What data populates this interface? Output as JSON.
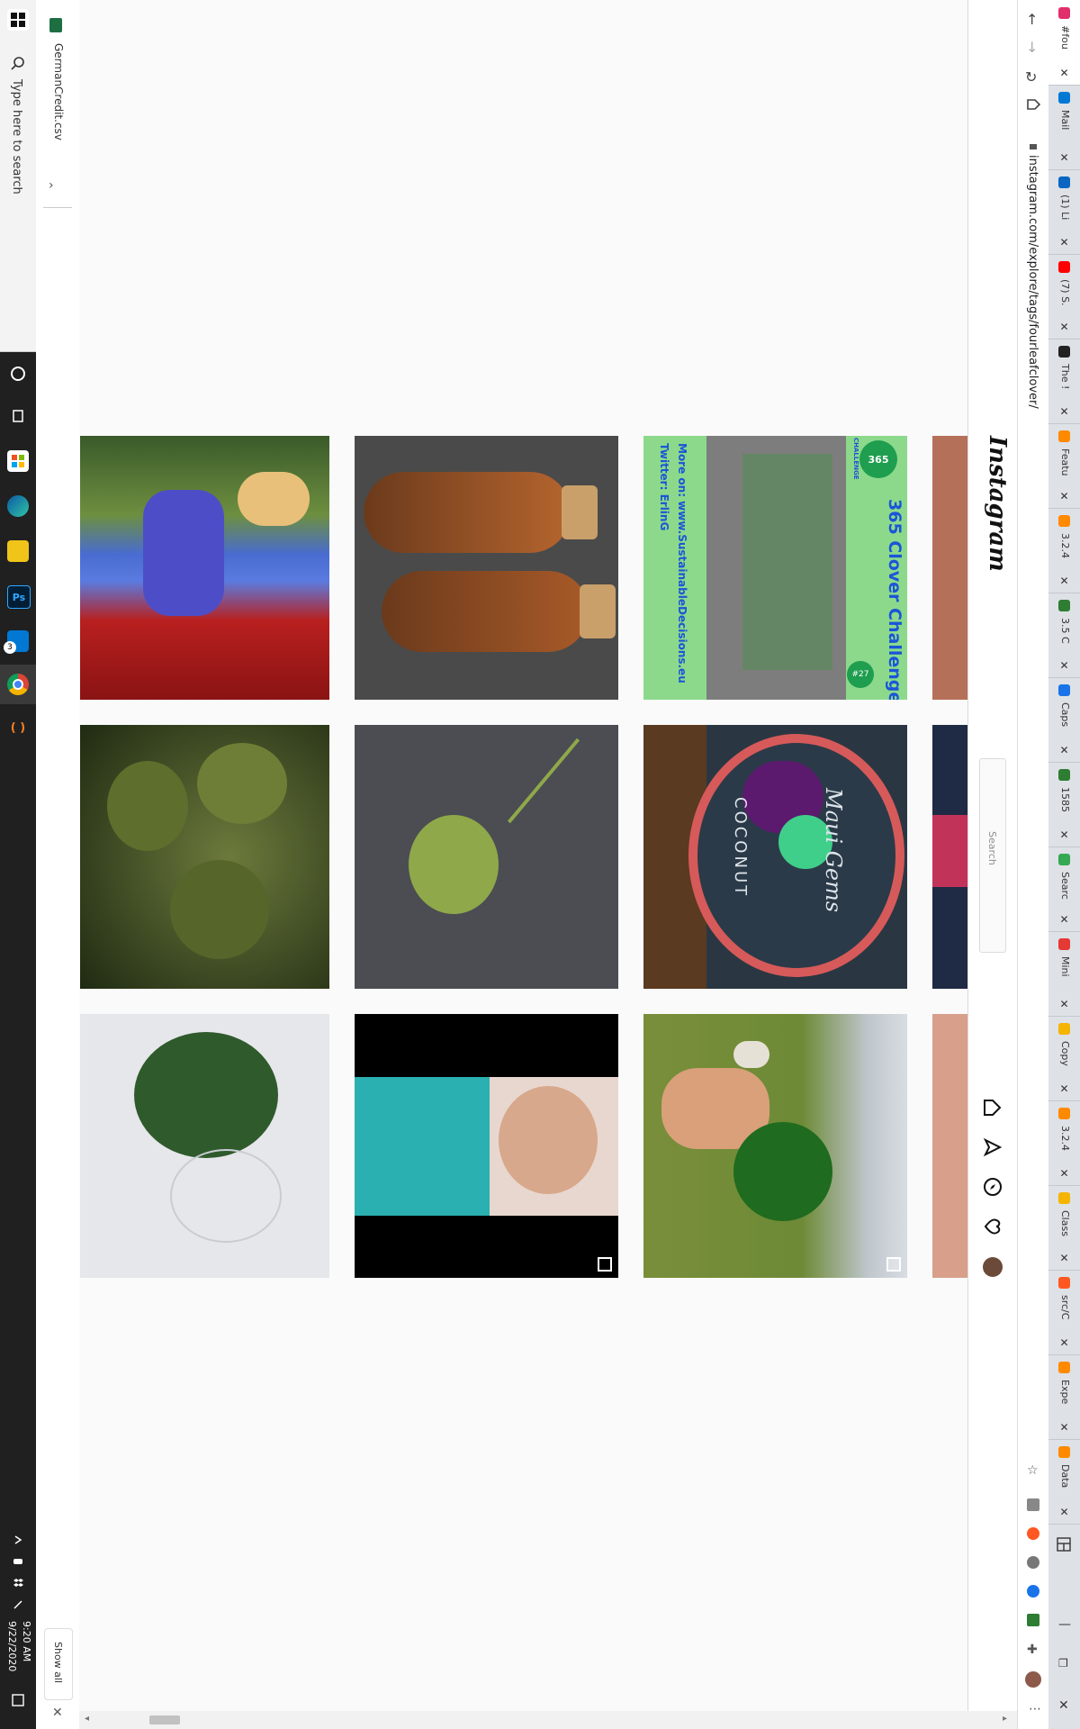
{
  "taskbar": {
    "search_placeholder": "Type here to search",
    "time": "9:20 AM",
    "date": "9/22/2020",
    "badge_count": "3"
  },
  "downloads": {
    "file_name": "GermanCredit.csv",
    "show_all": "Show all"
  },
  "browser": {
    "url": "instagram.com/explore/tags/fourleafclover/",
    "tabs": [
      {
        "label": "#fou",
        "color": "#e1306c",
        "active": true
      },
      {
        "label": "Mail",
        "color": "#0078d4"
      },
      {
        "label": "(1) Li",
        "color": "#0a66c2"
      },
      {
        "label": "(7) S.",
        "color": "#ff0000"
      },
      {
        "label": "The !",
        "color": "#222222"
      },
      {
        "label": "Featu",
        "color": "#ff8a00"
      },
      {
        "label": "3.2.4",
        "color": "#ff8a00"
      },
      {
        "label": "3.5 C",
        "color": "#2e7d32"
      },
      {
        "label": "Caps",
        "color": "#1a73e8"
      },
      {
        "label": "1585",
        "color": "#2e7d32"
      },
      {
        "label": "Searc",
        "color": "#34a853"
      },
      {
        "label": "Mini",
        "color": "#e53935"
      },
      {
        "label": "Copy",
        "color": "#f4b400"
      },
      {
        "label": "3.2.4",
        "color": "#ff8a00"
      },
      {
        "label": "Class",
        "color": "#f4b400"
      },
      {
        "label": "src/C",
        "color": "#ff5722"
      },
      {
        "label": "Expe",
        "color": "#ff8a00"
      },
      {
        "label": "Data",
        "color": "#ff8a00"
      }
    ]
  },
  "instagram": {
    "logo": "Instagram",
    "search_placeholder": "Search"
  },
  "posts": {
    "clover_challenge": {
      "title": "365 Clover Challenge",
      "line1": "More on: www.SustainableDecisions.eu",
      "line2": "Twitter: ErlinG",
      "logo_text": "365",
      "challenge": "CHALLENGE",
      "badge": "#27"
    },
    "coconut": {
      "script": "Maui Gems",
      "word": "COCONUT"
    }
  },
  "colors": {
    "taskbar": "#202020",
    "tab_strip": "#dee1e6",
    "accent_green": "#8cd98c"
  }
}
